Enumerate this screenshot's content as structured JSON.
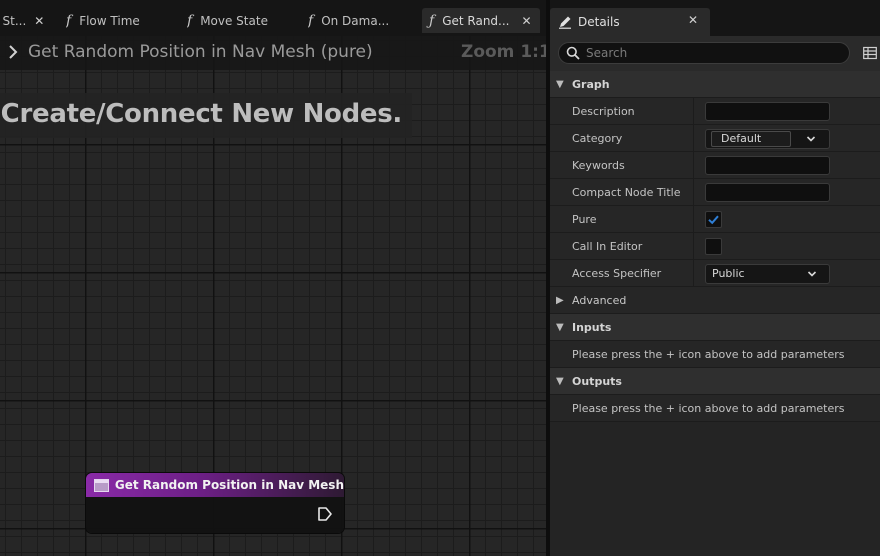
{
  "tabs": [
    {
      "label": "t St...",
      "close": "✕"
    },
    {
      "label": "Flow Time",
      "icon": "function-icon"
    },
    {
      "label": "Move State",
      "icon": "function-icon"
    },
    {
      "label": "On Dama...",
      "icon": "function-icon"
    },
    {
      "label": "Get Rand...",
      "icon": "function-icon",
      "close": "✕",
      "active": true
    }
  ],
  "graph": {
    "breadcrumb_arrow": ">",
    "title": "Get Random Position in Nav Mesh (pure)",
    "zoom": "Zoom 1:1",
    "hint": "s to Create/Connect New Nodes."
  },
  "node": {
    "title": "Get Random Position in Nav Mesh",
    "header_color": "#8a2aa8"
  },
  "details": {
    "tab_label": "Details",
    "tab_close": "✕",
    "search_placeholder": "Search",
    "sections": {
      "graph": "Graph",
      "advanced": "Advanced",
      "inputs": "Inputs",
      "outputs": "Outputs"
    },
    "properties": {
      "description": {
        "label": "Description",
        "value": ""
      },
      "category": {
        "label": "Category",
        "value": "Default"
      },
      "keywords": {
        "label": "Keywords",
        "value": ""
      },
      "compact_node_title": {
        "label": "Compact Node Title",
        "value": ""
      },
      "pure": {
        "label": "Pure",
        "checked": true
      },
      "call_in_editor": {
        "label": "Call In Editor",
        "checked": false
      },
      "access_specifier": {
        "label": "Access Specifier",
        "value": "Public"
      }
    },
    "inputs_message": "Please press the + icon above to add parameters",
    "outputs_message": "Please press the + icon above to add parameters"
  },
  "colors": {
    "checkbox_accent": "#2f7fd6",
    "node_header": "#8a2aa8"
  }
}
